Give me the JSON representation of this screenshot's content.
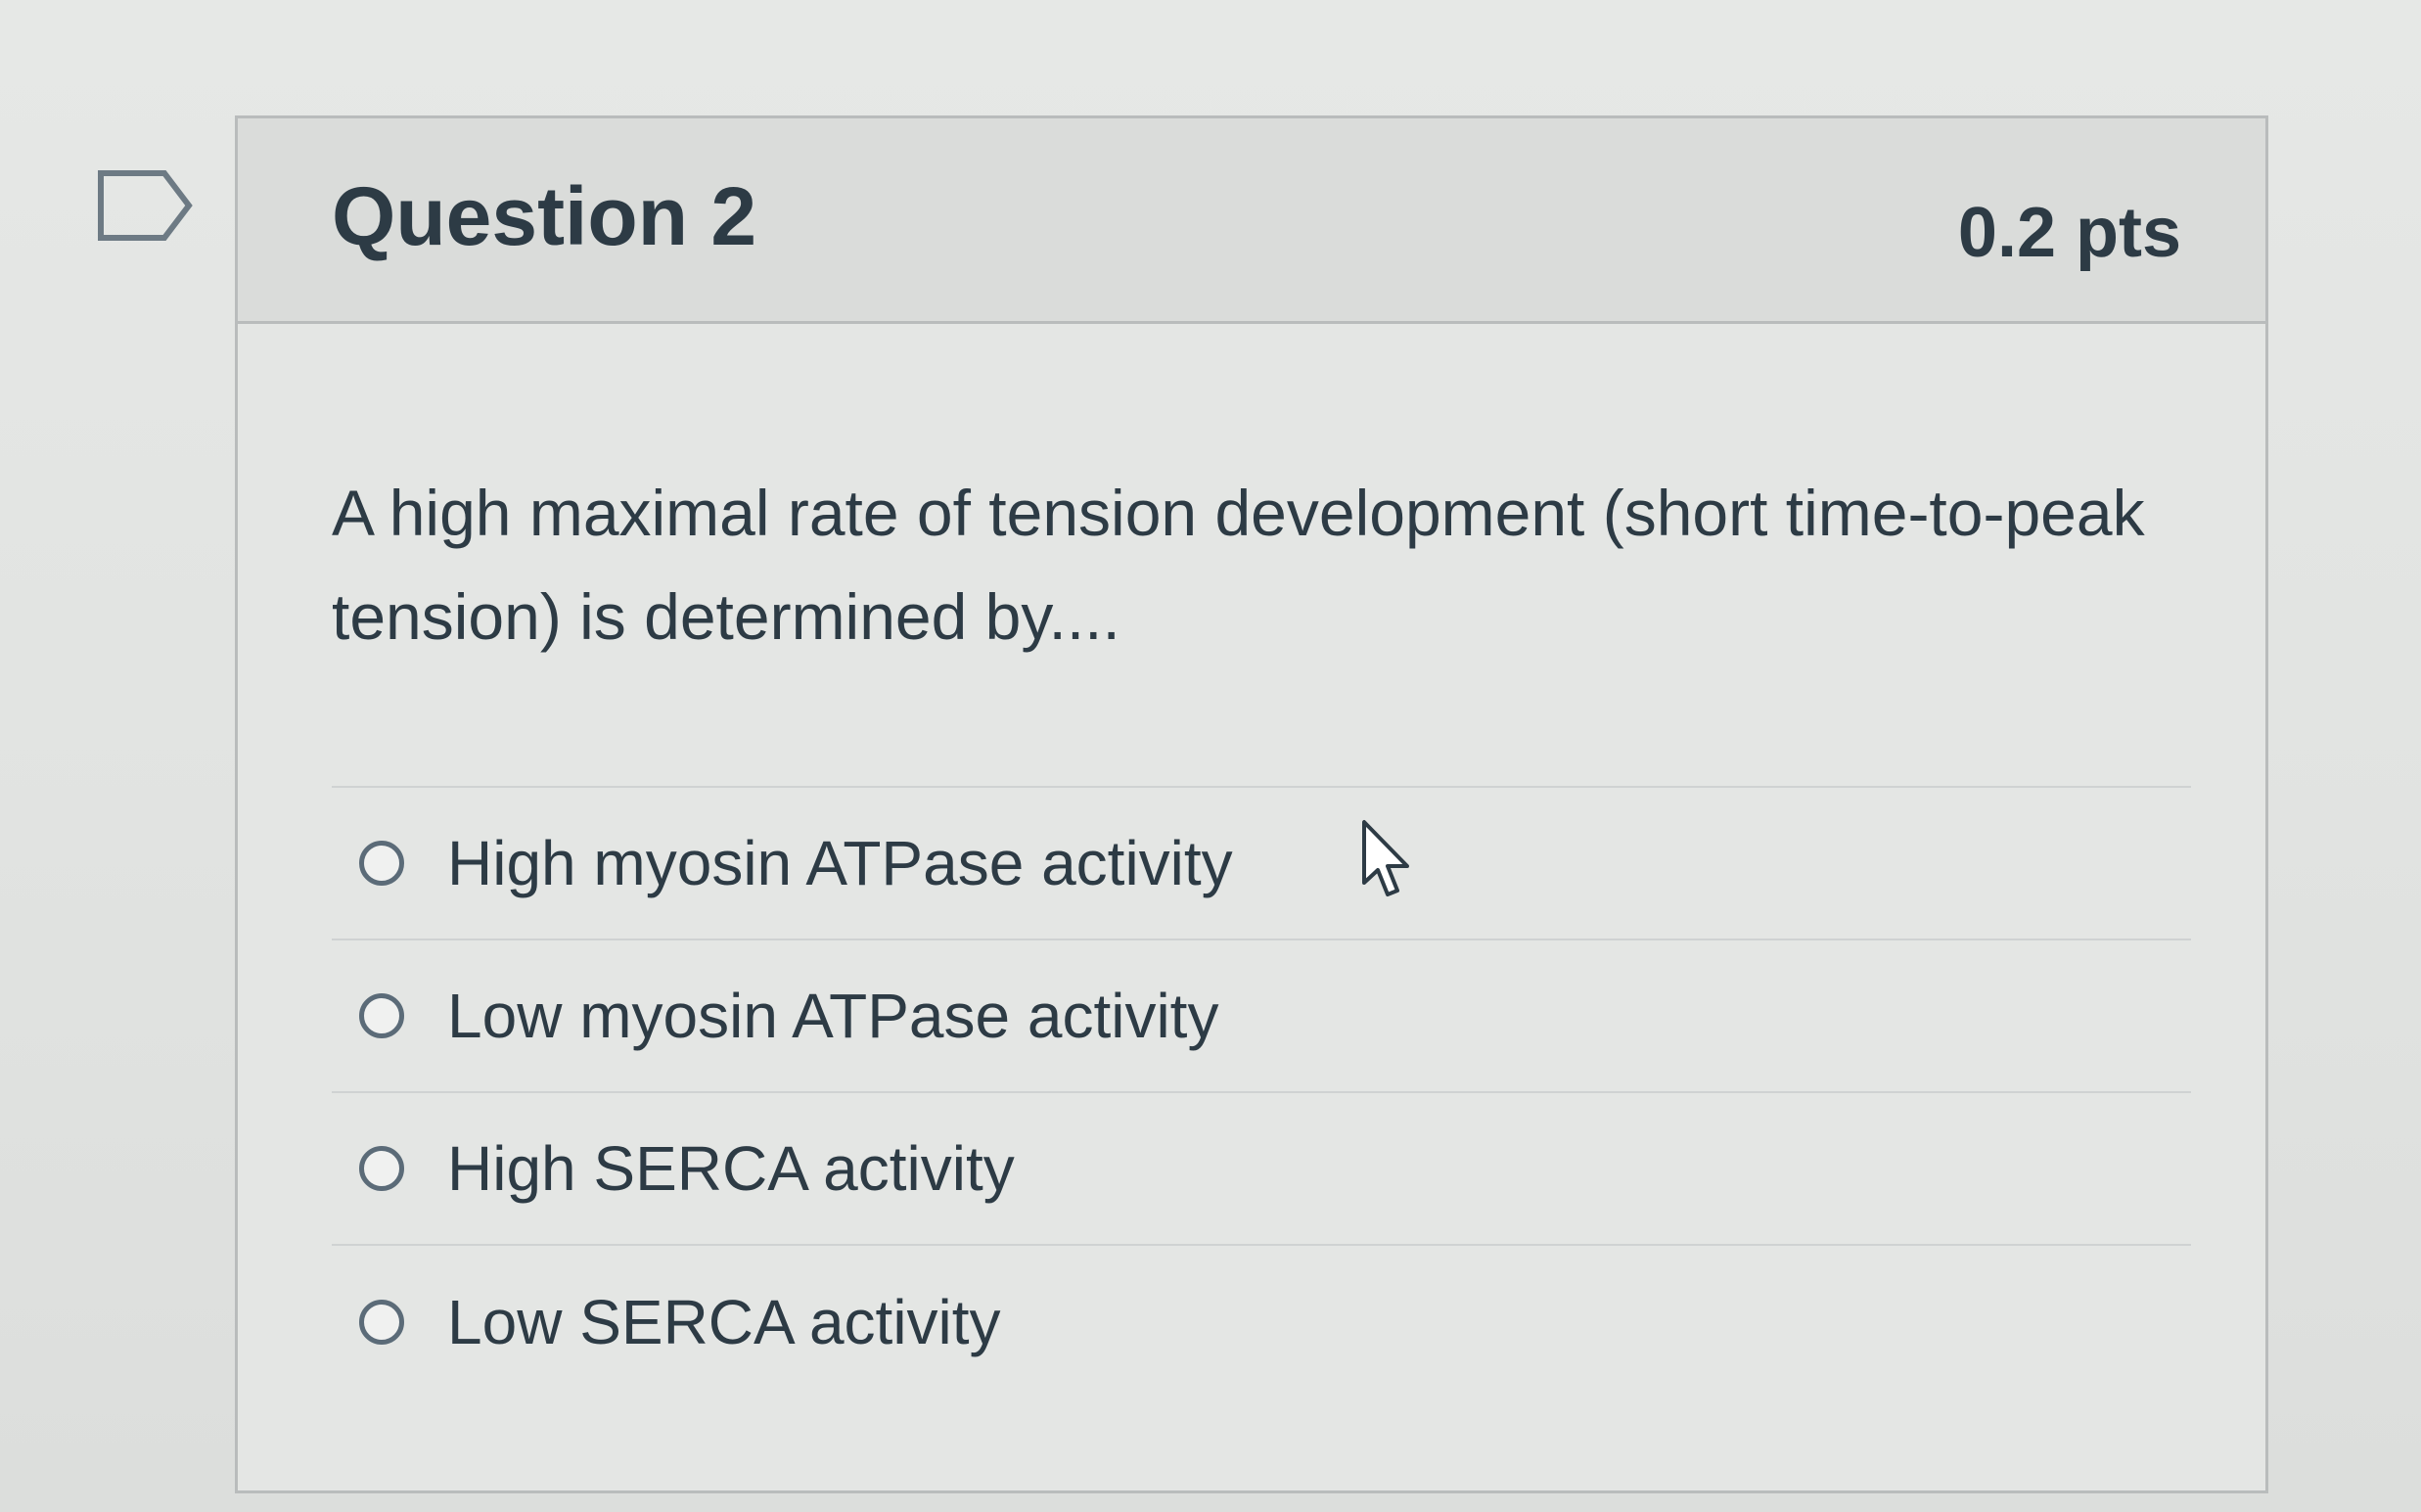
{
  "question": {
    "title": "Question 2",
    "points": "0.2 pts",
    "text": "A high maximal rate of tension development (short time-to-peak tension) is determined by....",
    "answers": [
      {
        "label": "High myosin ATPase activity",
        "selected": false
      },
      {
        "label": "Low myosin ATPase activity",
        "selected": false
      },
      {
        "label": "High SERCA activity",
        "selected": false
      },
      {
        "label": "Low SERCA activity",
        "selected": false
      }
    ]
  },
  "icons": {
    "flag": "flag-question-icon",
    "cursor": "mouse-pointer-icon",
    "radio": "radio-button-icon"
  },
  "colors": {
    "text": "#2d3b45",
    "border": "#b9bcbc",
    "header_bg": "#dadcda",
    "page_bg": "#e4e6e4"
  }
}
